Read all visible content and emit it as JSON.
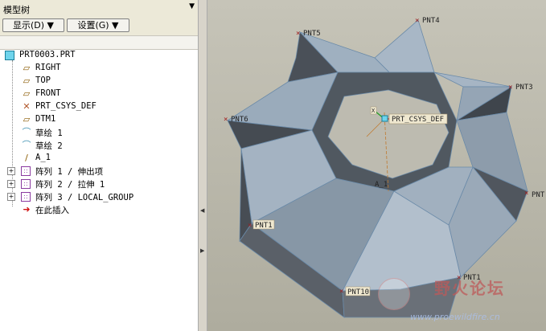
{
  "panel": {
    "title": "模型树",
    "collapse_icon": "▼",
    "show_button": "显示(D) ▼",
    "settings_button": "设置(G) ▼"
  },
  "tree": {
    "root": "PRT0003.PRT",
    "items": [
      {
        "label": "RIGHT",
        "icon": "datum-plane-icon"
      },
      {
        "label": "TOP",
        "icon": "datum-plane-icon"
      },
      {
        "label": "FRONT",
        "icon": "datum-plane-icon"
      },
      {
        "label": "PRT_CSYS_DEF",
        "icon": "csys-icon"
      },
      {
        "label": "DTM1",
        "icon": "datum-plane-icon"
      },
      {
        "label": "草绘 1",
        "icon": "sketch-icon"
      },
      {
        "label": "草绘 2",
        "icon": "sketch-icon"
      },
      {
        "label": "A_1",
        "icon": "datum-axis-icon"
      },
      {
        "label": "阵列 1 / 伸出项",
        "icon": "pattern-icon"
      },
      {
        "label": "阵列 2 / 拉伸 1",
        "icon": "pattern-icon"
      },
      {
        "label": "阵列 3 / LOCAL_GROUP",
        "icon": "pattern-icon"
      },
      {
        "label": "在此插入",
        "icon": "insert-here-icon"
      }
    ]
  },
  "viewport": {
    "points": [
      "PNT4",
      "PNT5",
      "PNT3",
      "PNT6",
      "PNT",
      "PNT1",
      "PNT10",
      "PNT1"
    ],
    "csys_label": "PRT_CSYS_DEF",
    "axis_label": "A_1",
    "axis_x_label": "X"
  },
  "watermark": {
    "text": "野火论坛",
    "url": "www.proewildfire.cn"
  }
}
